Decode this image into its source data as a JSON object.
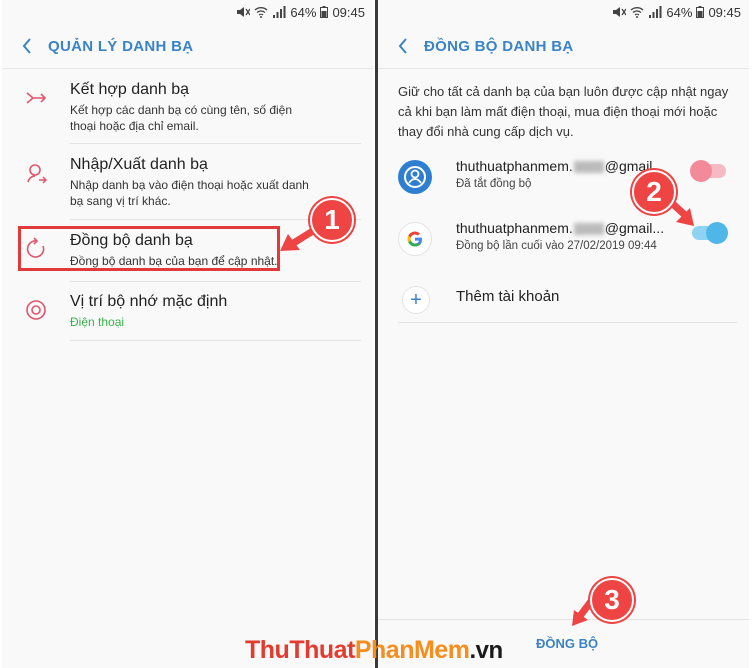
{
  "status": {
    "battery": "64%",
    "time": "09:45"
  },
  "left": {
    "title": "QUẢN LÝ DANH BẠ",
    "items": [
      {
        "title": "Kết hợp danh bạ",
        "subtitle": "Kết hợp các danh bạ có cùng tên, số điện thoại hoặc địa chỉ email.",
        "icon": "merge-icon"
      },
      {
        "title": "Nhập/Xuất danh bạ",
        "subtitle": "Nhập danh bạ vào điện thoại hoặc xuất danh bạ sang vị trí khác.",
        "icon": "import-export-icon"
      },
      {
        "title": "Đồng bộ danh bạ",
        "subtitle": "Đồng bộ danh bạ của bạn để cập nhật.",
        "icon": "sync-icon"
      },
      {
        "title": "Vị trí bộ nhớ mặc định",
        "subtitle": "Điện thoại",
        "icon": "storage-icon"
      }
    ]
  },
  "right": {
    "title": "ĐỒNG BỘ DANH BẠ",
    "description": "Giữ cho tất cả danh bạ của bạn luôn được cập nhật ngay cả khi bạn làm mất điện thoại, mua điện thoại mới hoặc thay đổi nhà cung cấp dịch vụ.",
    "accounts": [
      {
        "name_prefix": "thuthuatphanmem.",
        "name_suffix": "@gmail...",
        "status": "Đã tắt đồng bộ",
        "toggle_on": false,
        "icon": "samsung-account-icon"
      },
      {
        "name_prefix": "thuthuatphanmem.",
        "name_suffix": "@gmail...",
        "status": "Đồng bộ lần cuối vào 27/02/2019  09:44",
        "toggle_on": true,
        "icon": "google-icon"
      }
    ],
    "add_account": "Thêm tài khoản",
    "sync_button": "ĐỒNG BỘ"
  },
  "callouts": [
    "1",
    "2",
    "3"
  ],
  "watermark": {
    "part1": "ThuThuat",
    "part2": "PhanMem",
    "part3": ".vn"
  },
  "colors": {
    "accent": "#3a83c6",
    "icon_red": "#e0566b",
    "callout": "#e44444",
    "toggle_on": "#4fb7e8",
    "toggle_off": "#f28a9a",
    "green_sub": "#39b24a"
  }
}
